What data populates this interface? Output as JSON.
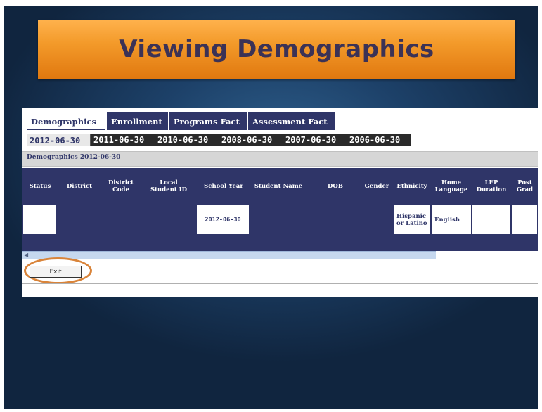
{
  "slide": {
    "title": "Viewing Demographics"
  },
  "tabs": [
    {
      "label": "Demographics",
      "active": true
    },
    {
      "label": "Enrollment",
      "active": false
    },
    {
      "label": "Programs Fact",
      "active": false
    },
    {
      "label": "Assessment Fact",
      "active": false
    }
  ],
  "date_tabs": [
    {
      "label": "2012-06-30",
      "active": true
    },
    {
      "label": "2011-06-30",
      "active": false
    },
    {
      "label": "2010-06-30",
      "active": false
    },
    {
      "label": "2008-06-30",
      "active": false
    },
    {
      "label": "2007-06-30",
      "active": false
    },
    {
      "label": "2006-06-30",
      "active": false
    }
  ],
  "section": {
    "title": "Demographics 2012-06-30"
  },
  "table": {
    "columns": [
      "Status",
      "District",
      "District Code",
      "Local Student ID",
      "School Year",
      "Student Name",
      "DOB",
      "Gender",
      "Ethnicity",
      "Home Language",
      "LEP Duration",
      "Post Grad"
    ],
    "row": {
      "status": "",
      "district": "",
      "district_code": "",
      "local_student_id": "",
      "school_year": "2012-06-30",
      "student_name": "",
      "dob": "",
      "gender": "",
      "ethnicity": "Hispanic or Latino",
      "home_language": "English",
      "lep_duration": "",
      "post_grad": ""
    }
  },
  "scrollbar": {
    "arrow_icon": "scroll-left-arrow"
  },
  "exit_button": {
    "label": "Exit"
  },
  "colors": {
    "banner": "#f39a2a",
    "title_text": "#3b3256",
    "table_header": "#2f3568",
    "highlight_circle": "#d9843a"
  }
}
